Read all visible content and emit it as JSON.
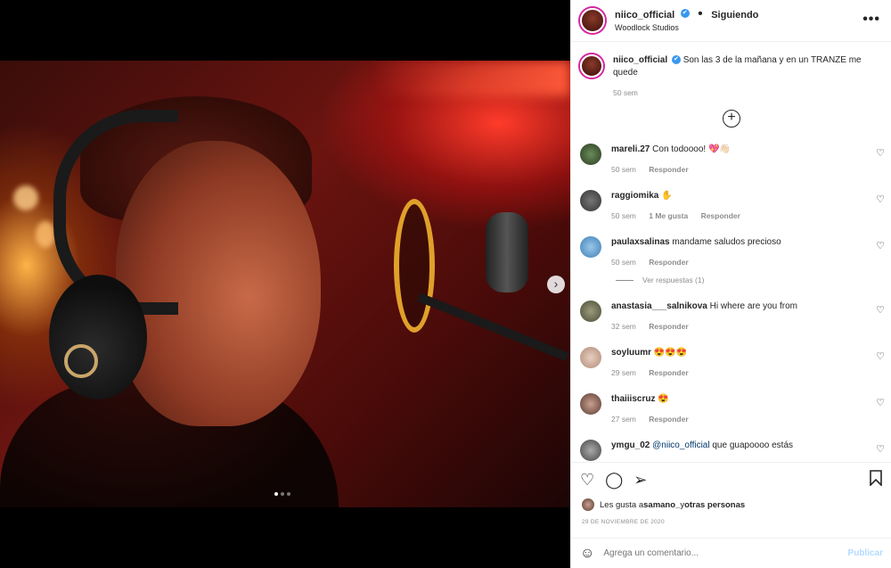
{
  "post": {
    "username": "niico_official",
    "verified_label": "✔",
    "follow_status": "Siguiendo",
    "separator": "•",
    "location": "Woodlock Studios",
    "more_label": "•••"
  },
  "carousel": {
    "next_label": "›",
    "slide_count": 3,
    "active_slide": 1
  },
  "caption": {
    "username": "niico_official",
    "text": "Son las 3 de la mañana y en un TRANZE me quede",
    "time": "50 sem"
  },
  "load_more_label": "+",
  "comments": [
    {
      "username": "mareli.27",
      "text": "Con todoooo! 💖👋🏻",
      "time": "50 sem",
      "likes": "",
      "reply": "Responder"
    },
    {
      "username": "raggiomika",
      "text": "✋",
      "time": "50 sem",
      "likes": "1 Me gusta",
      "reply": "Responder"
    },
    {
      "username": "paulaxsalinas",
      "text": "mandame saludos precioso",
      "time": "50 sem",
      "likes": "",
      "reply": "Responder",
      "view_replies": "Ver respuestas (1)"
    },
    {
      "username": "anastasia___salnikova",
      "text": "Hi where are you from",
      "time": "32 sem",
      "likes": "",
      "reply": "Responder"
    },
    {
      "username": "soyluumr",
      "text": "😍😍😍",
      "time": "29 sem",
      "likes": "",
      "reply": "Responder"
    },
    {
      "username": "thaiiiscruz",
      "text": "😍",
      "time": "27 sem",
      "likes": "",
      "reply": "Responder"
    },
    {
      "username": "ymgu_02",
      "mention": "@niico_official",
      "text": " que guapoooo estás",
      "time": "",
      "likes": "",
      "reply": ""
    }
  ],
  "actions": {
    "like": "♡",
    "comment": "◯",
    "share": "➢",
    "save": "🔖"
  },
  "likes_line": {
    "prefix": "Les gusta a ",
    "user": "samano_",
    "middle": " y ",
    "others": "otras personas"
  },
  "date": "29 DE NOVIEMBRE DE 2020",
  "add_comment": {
    "placeholder": "Agrega un comentario...",
    "emoji": "☺",
    "publish": "Publicar"
  },
  "colors": {
    "link": "#00376b",
    "publish_disabled": "#b3dbff",
    "verified": "#3897f0"
  }
}
